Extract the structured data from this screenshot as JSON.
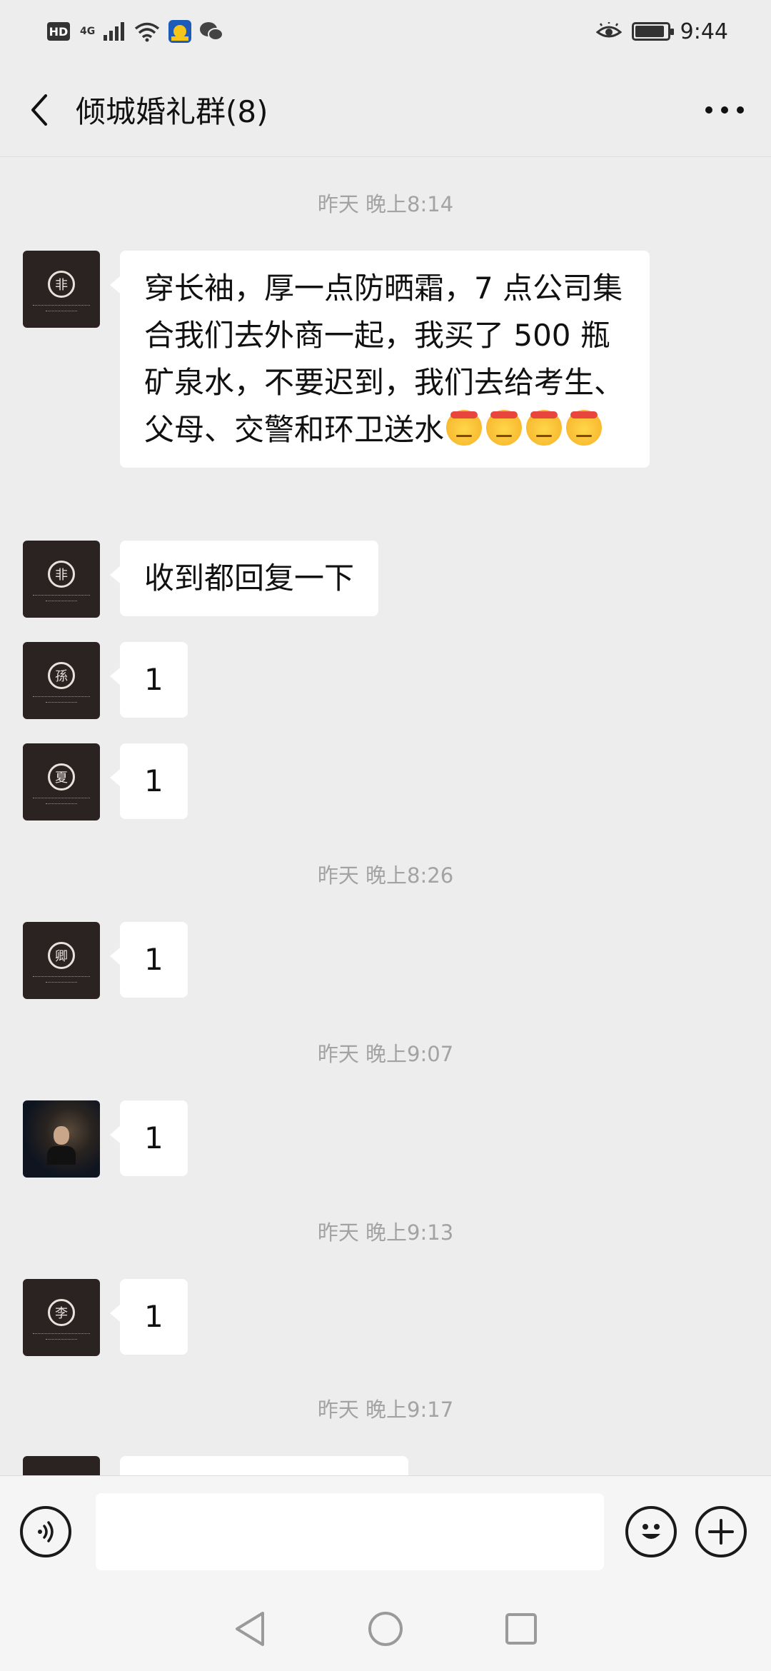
{
  "status_bar": {
    "hd": "HD",
    "network": "4G",
    "time": "9:44"
  },
  "header": {
    "title": "倾城婚礼群(8)"
  },
  "messages": [
    {
      "time": "昨天 晚上8:14"
    },
    {
      "text": "穿长袖，厚一点防晒霜，7 点公司集合我们去外商一起，我买了 500 瓶矿泉水，不要迟到，我们去给考生、父母、交警和环卫送水"
    },
    {
      "text": "收到都回复一下"
    },
    {
      "text": "1"
    },
    {
      "text": "1"
    },
    {
      "time": "昨天 晚上8:26"
    },
    {
      "text": "1"
    },
    {
      "time": "昨天 晚上9:07"
    },
    {
      "text": "1"
    },
    {
      "time": "昨天 晚上9:13"
    },
    {
      "text": "1"
    },
    {
      "time": "昨天 晚上9:17"
    }
  ],
  "avatars": {
    "a1": "非",
    "a2": "孫",
    "a3": "夏",
    "a4": "卿",
    "a5": "李"
  },
  "icons": {
    "back": "chevron-left-icon",
    "more": "more-dots-icon",
    "voice": "voice-icon",
    "emoji": "emoji-icon",
    "plus": "plus-icon"
  },
  "colors": {
    "background": "#ededed",
    "bubble": "#ffffff",
    "time_text": "#a3a3a3"
  }
}
